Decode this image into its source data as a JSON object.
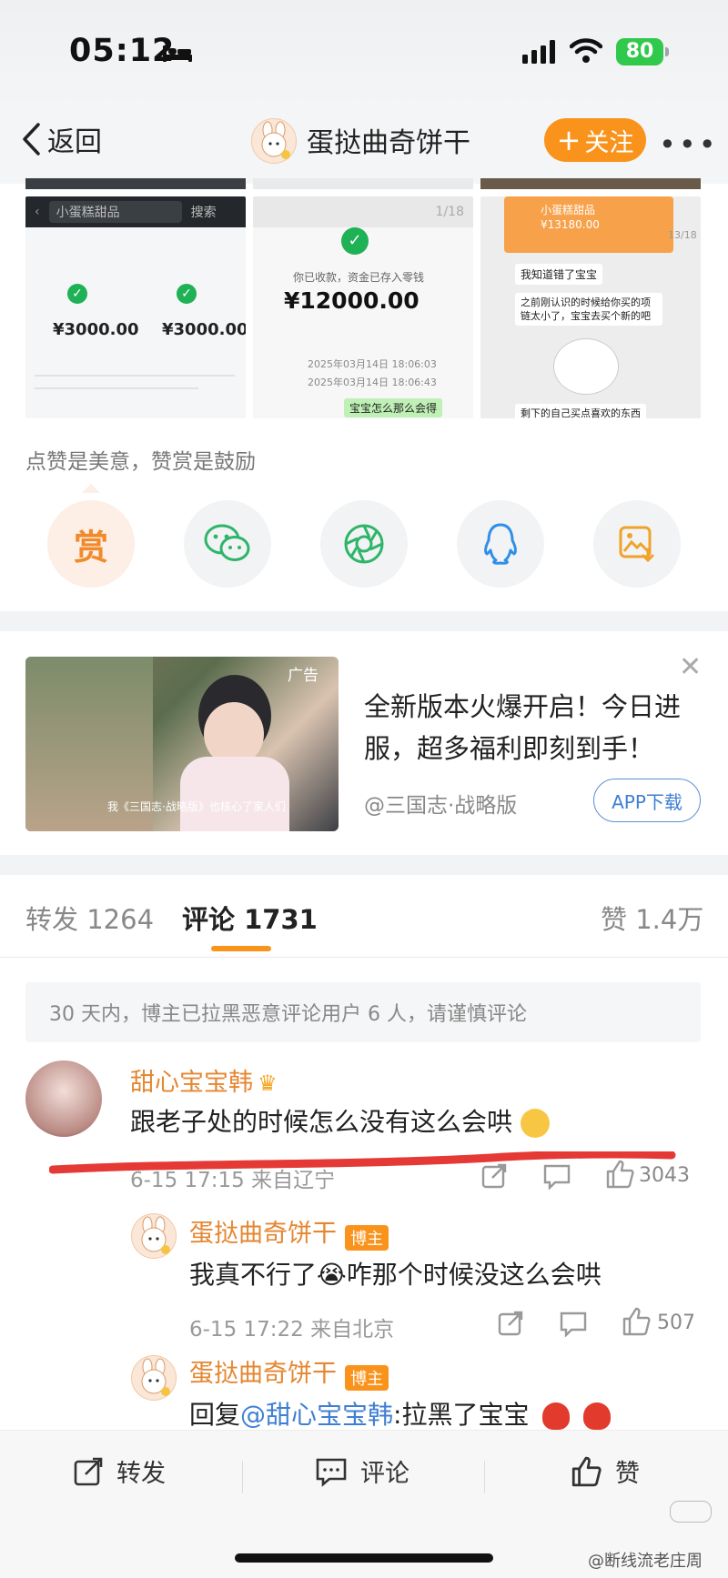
{
  "status": {
    "time": "05:12",
    "battery": "80"
  },
  "nav": {
    "back_label": "返回",
    "title": "蛋挞曲奇饼干",
    "follow_label": "关注"
  },
  "thumbs": {
    "t1": {
      "search": "小蛋糕甜品",
      "search_btn": "搜索",
      "amount1": "¥3000.00",
      "amount2": "¥3000.00"
    },
    "t2": {
      "pager": "1/18",
      "received": "你已收款，资金已存入零钱",
      "amount": "¥12000.00",
      "time1": "2025年03月14日 18:06:03",
      "time2": "2025年03月14日 18:06:43",
      "bubble": "宝宝怎么那么会得"
    },
    "t3": {
      "name": "小蛋糕甜品",
      "amount": "¥13180.00",
      "pager": "13/18",
      "msg1": "我知道错了宝宝",
      "msg2": "之前刚认识的时候给你买的项链太小了，宝宝去买个新的吧",
      "msg3": "剩下的自己买点喜欢的东西"
    }
  },
  "praise": {
    "text": "点赞是美意，赞赏是鼓励",
    "reward_label": "赏"
  },
  "share": [
    {
      "name": "reward"
    },
    {
      "name": "wechat"
    },
    {
      "name": "moments"
    },
    {
      "name": "qq"
    },
    {
      "name": "save-image"
    }
  ],
  "ad": {
    "tag": "广告",
    "caption": "我《三国志·战略版》也核心了家人们",
    "headline": "全新版本火爆开启！今日进服，超多福利即刻到手！",
    "source": "@三国志·战略版",
    "button": "APP下载"
  },
  "tabs": {
    "repost": "转发 1264",
    "comment": "评论 1731",
    "like": "赞 1.4万"
  },
  "notice": "30 天内，博主已拉黑恶意评论用户 6 人，请谨慎评论",
  "comments": [
    {
      "name": "甜心宝宝韩",
      "text": "跟老子处的时候怎么没有这么会哄",
      "meta": "6-15 17:15 来自辽宁",
      "likes": "3043"
    },
    {
      "name": "蛋挞曲奇饼干",
      "badge": "博主",
      "text": "我真不行了😭咋那个时候没这么会哄",
      "meta": "6-15 17:22 来自北京",
      "likes": "507"
    },
    {
      "name": "蛋挞曲奇饼干",
      "badge": "博主",
      "reply_prefix": "回复",
      "reply_at": "@甜心宝宝韩",
      "reply_text": ":拉黑了宝宝"
    }
  ],
  "bottom": {
    "repost": "转发",
    "comment": "评论",
    "like": "赞"
  },
  "watermark": "@断线流老庄周",
  "colors": {
    "accent": "#f9931c",
    "name": "#e58631",
    "link": "#3f7fd3",
    "wechat_green": "#1fb155"
  }
}
